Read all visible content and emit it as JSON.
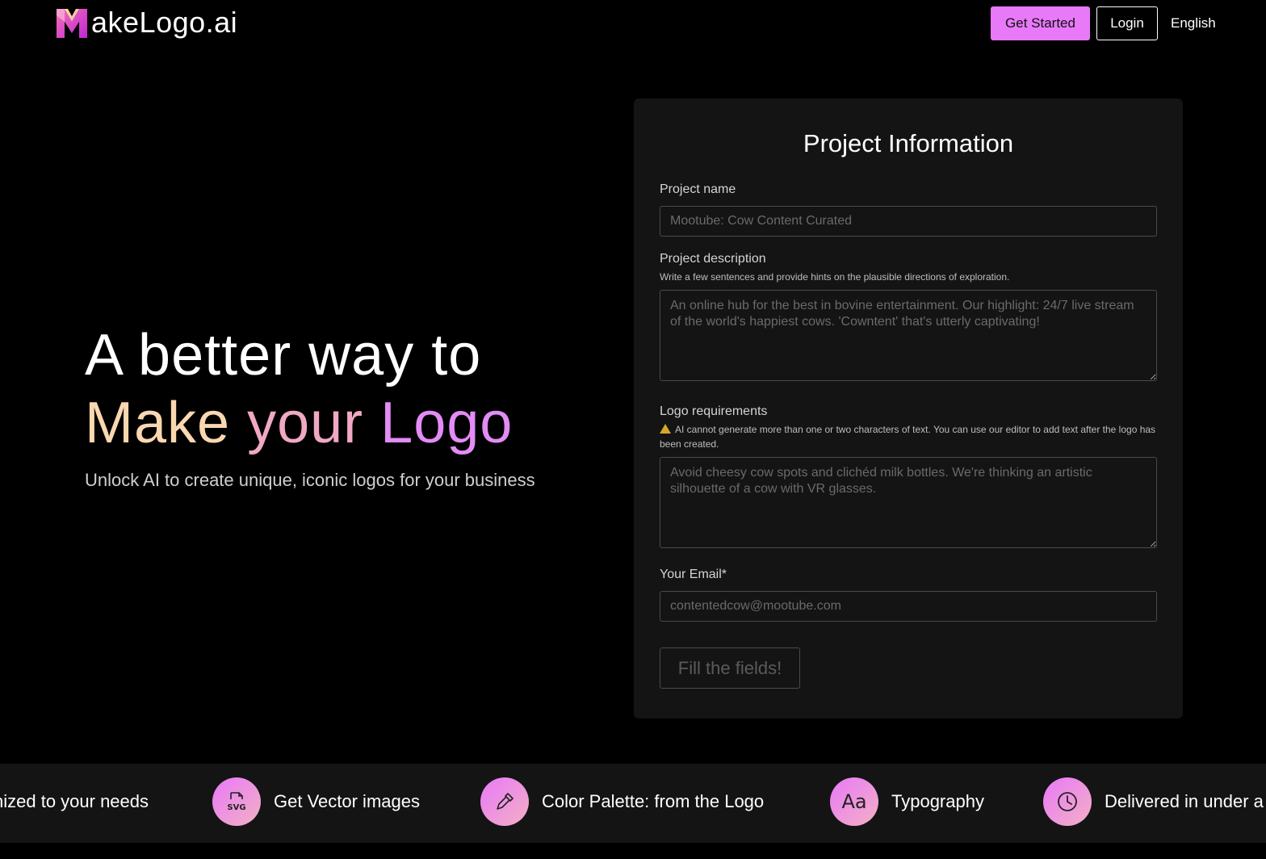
{
  "header": {
    "logo_text": "akeLogo.ai",
    "get_started_label": "Get Started",
    "login_label": "Login",
    "language": "English"
  },
  "hero": {
    "line1": "A better way to",
    "line2_word1": "Make",
    "line2_word2": "your",
    "line2_word3": "Logo",
    "subtitle": "Unlock AI to create unique, iconic logos for your business",
    "colors": {
      "make": "#f9d7b0",
      "your": "#f0a8c4",
      "logo": "#e38cf5"
    }
  },
  "form": {
    "title": "Project Information",
    "project_name_label": "Project name",
    "project_name_placeholder": "Mootube: Cow Content Curated",
    "project_description_label": "Project description",
    "project_description_hint": "Write a few sentences and provide hints on the plausible directions of exploration.",
    "project_description_placeholder": "An online hub for the best in bovine entertainment. Our highlight: 24/7 live stream of the world's happiest cows. 'Cowntent' that's utterly captivating!",
    "logo_requirements_label": "Logo requirements",
    "logo_requirements_hint": "AI cannot generate more than one or two characters of text. You can use our editor to add text after the logo has been created.",
    "logo_requirements_placeholder": "Avoid cheesy cow spots and clichéd milk bottles. We're thinking an artistic silhouette of a cow with VR glasses.",
    "email_label": "Your Email*",
    "email_placeholder": "contentedcow@mootube.com",
    "submit_label": "Fill the fields!"
  },
  "features": [
    {
      "label": "nized to your needs",
      "icon": "none"
    },
    {
      "label": "Get Vector images",
      "icon": "svg-file-icon"
    },
    {
      "label": "Color Palette: from the Logo",
      "icon": "eyedropper-icon"
    },
    {
      "label": "Typography",
      "icon": "typography-icon"
    },
    {
      "label": "Delivered in under a",
      "icon": "clock-icon"
    }
  ],
  "icon_glyphs": {
    "svg_text": "SVG",
    "typography_text": "Aa"
  },
  "colors": {
    "accent": "#e879f9",
    "card_bg": "#141414",
    "page_bg": "#000000"
  }
}
